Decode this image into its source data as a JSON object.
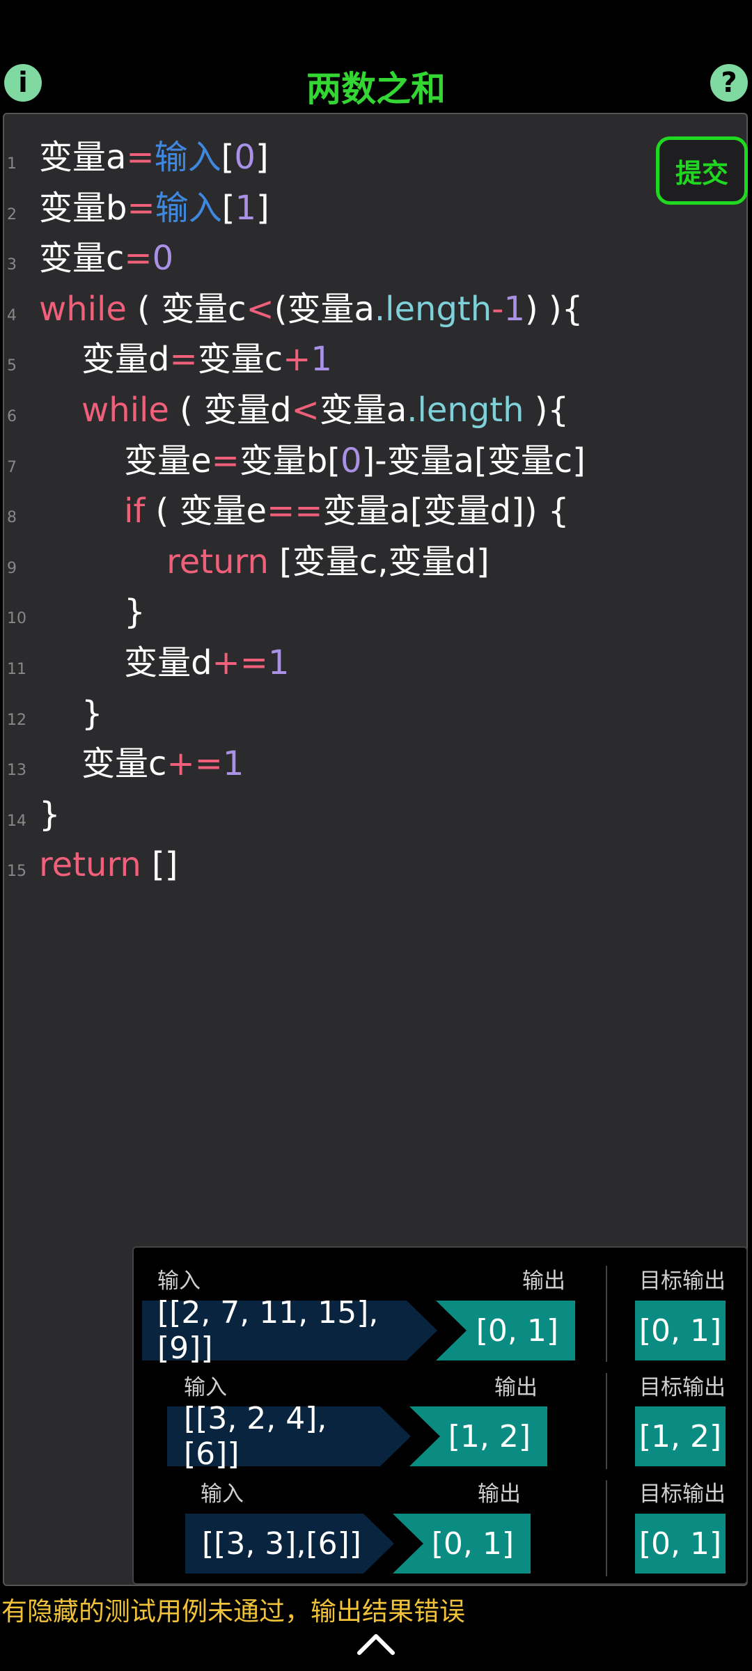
{
  "header": {
    "title": "两数之和",
    "info_icon": "i",
    "help_icon": "?"
  },
  "editor": {
    "submit_label": "提交",
    "line_numbers": [
      "1",
      "2",
      "3",
      "4",
      "5",
      "6",
      "7",
      "8",
      "9",
      "10",
      "11",
      "12",
      "13",
      "14",
      "15"
    ],
    "lines": [
      [
        [
          "w",
          "变量a"
        ],
        [
          "op",
          "="
        ],
        [
          "blue",
          "输入"
        ],
        [
          "w",
          "["
        ],
        [
          "num",
          "0"
        ],
        [
          "w",
          "]"
        ]
      ],
      [
        [
          "w",
          "变量b"
        ],
        [
          "op",
          "="
        ],
        [
          "blue",
          "输入"
        ],
        [
          "w",
          "["
        ],
        [
          "num",
          "1"
        ],
        [
          "w",
          "]"
        ]
      ],
      [
        [
          "w",
          "变量c"
        ],
        [
          "op",
          "="
        ],
        [
          "num",
          "0"
        ]
      ],
      [
        [
          "kw",
          "while"
        ],
        [
          "w",
          " ( 变量c"
        ],
        [
          "op",
          "<"
        ],
        [
          "w",
          "(变量a"
        ],
        [
          "prop",
          ".length"
        ],
        [
          "op",
          "-"
        ],
        [
          "num",
          "1"
        ],
        [
          "w",
          ") ){"
        ]
      ],
      [
        [
          "w",
          "    变量d"
        ],
        [
          "op",
          "="
        ],
        [
          "w",
          "变量c"
        ],
        [
          "op",
          "+"
        ],
        [
          "num",
          "1"
        ]
      ],
      [
        [
          "kw",
          "    while"
        ],
        [
          "w",
          " ( 变量d"
        ],
        [
          "op",
          "<"
        ],
        [
          "w",
          "变量a"
        ],
        [
          "prop",
          ".length"
        ],
        [
          "w",
          " ){"
        ]
      ],
      [
        [
          "w",
          "        变量e"
        ],
        [
          "op",
          "="
        ],
        [
          "w",
          "变量b["
        ],
        [
          "num",
          "0"
        ],
        [
          "w",
          "]-变量a[变量c]"
        ]
      ],
      [
        [
          "kw",
          "        if"
        ],
        [
          "w",
          " ( 变量e"
        ],
        [
          "op",
          "=="
        ],
        [
          "w",
          "变量a[变量d]) {"
        ]
      ],
      [
        [
          "kw",
          "            return"
        ],
        [
          "w",
          " [变量c,变量d]"
        ]
      ],
      [
        [
          "w",
          "        }"
        ]
      ],
      [
        [
          "w",
          "        变量d"
        ],
        [
          "op",
          "+="
        ],
        [
          "num",
          "1"
        ]
      ],
      [
        [
          "w",
          "    }"
        ]
      ],
      [
        [
          "w",
          "    变量c"
        ],
        [
          "op",
          "+="
        ],
        [
          "num",
          "1"
        ]
      ],
      [
        [
          "w",
          "}"
        ]
      ],
      [
        [
          "kw",
          "return"
        ],
        [
          "w",
          " []"
        ]
      ]
    ]
  },
  "tests": {
    "input_label": "输入",
    "output_label": "输出",
    "target_label": "目标输出",
    "cases": [
      {
        "input": "[[2, 7, 11, 15],[9]]",
        "output": "[0, 1]",
        "target": "[0, 1]"
      },
      {
        "input": "[[3, 2, 4],[6]]",
        "output": "[1, 2]",
        "target": "[1, 2]"
      },
      {
        "input": "[[3, 3],[6]]",
        "output": "[0, 1]",
        "target": "[0, 1]"
      }
    ]
  },
  "status": {
    "message": "有隐藏的测试用例未通过，输出结果错误"
  },
  "colors": {
    "title_green": "#33d633",
    "submit_green": "#1fd81f",
    "keyword": "#f0607a",
    "number": "#a992e6",
    "property": "#7fd1d9",
    "input_builtin": "#3f88e0",
    "status_yellow": "#f0c23a",
    "teal": "#0b8c82",
    "navy": "#08243f"
  }
}
